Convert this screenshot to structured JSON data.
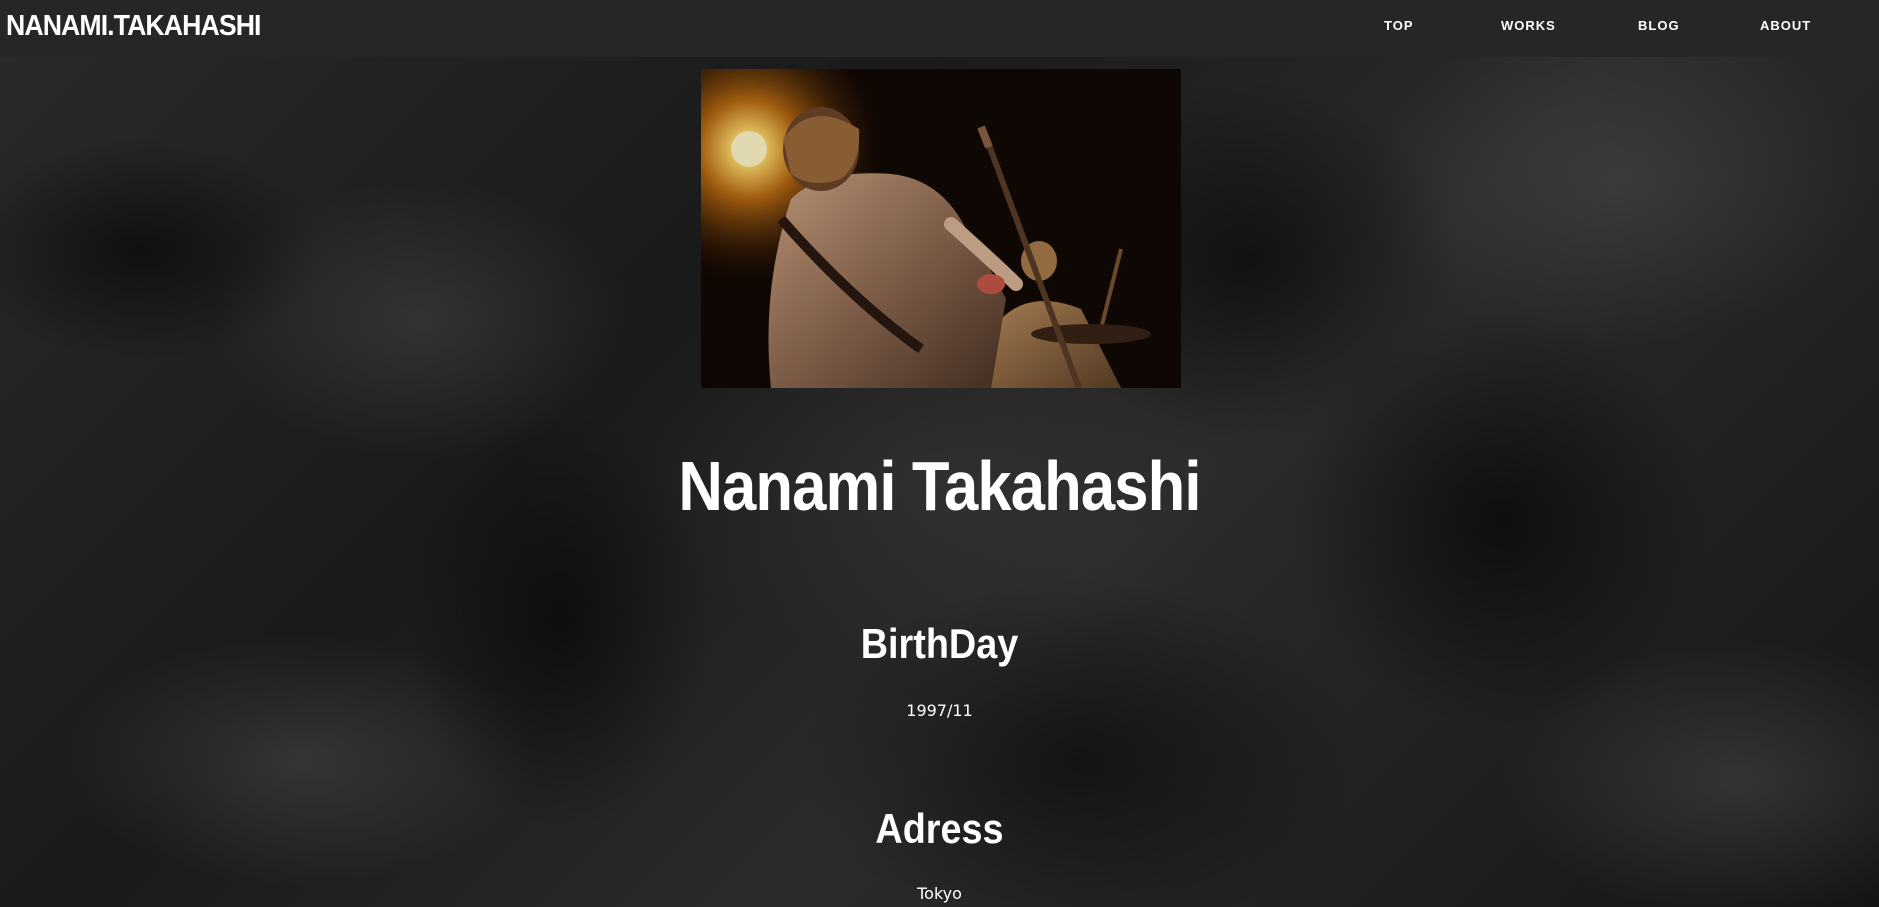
{
  "header": {
    "brand": "NANAMI.TAKAHASHI",
    "nav": [
      {
        "label": "TOP"
      },
      {
        "label": "WORKS"
      },
      {
        "label": "BLOG"
      },
      {
        "label": "ABOUT"
      }
    ]
  },
  "profile": {
    "name": "Nanami Takahashi",
    "photo_subject": "guitarist performing on stage under warm spotlight",
    "sections": [
      {
        "heading": "BirthDay",
        "value": "1997/11"
      },
      {
        "heading": "Adress",
        "value": "Tokyo"
      }
    ]
  },
  "colors": {
    "header_bg": "#262626",
    "text": "#ffffff",
    "page_bg": "#1c1c1c"
  }
}
